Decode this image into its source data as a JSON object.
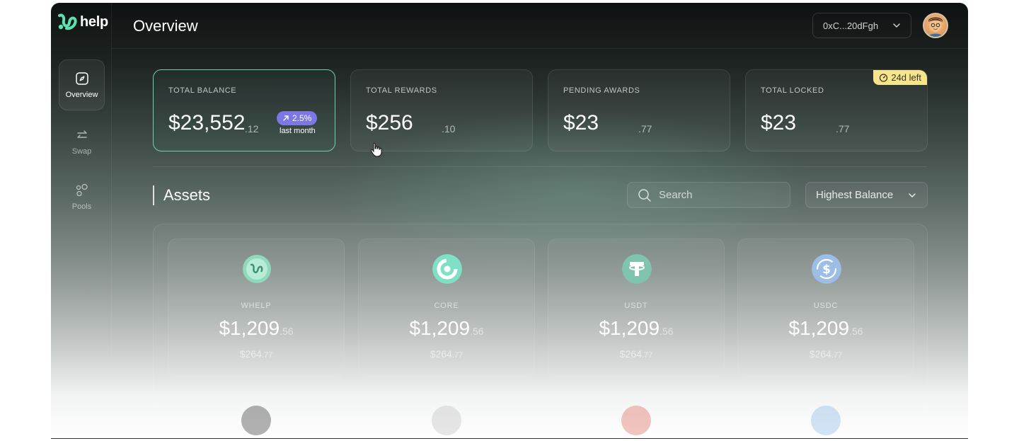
{
  "brand": {
    "name": "help"
  },
  "sidebar": {
    "items": [
      {
        "label": "Overview",
        "icon": "compass-icon",
        "active": true
      },
      {
        "label": "Swap",
        "icon": "swap-arrows-icon",
        "active": false
      },
      {
        "label": "Pools",
        "icon": "pools-bubbles-icon",
        "active": false
      }
    ]
  },
  "header": {
    "title": "Overview",
    "wallet_address": "0xC...20dFgh"
  },
  "stats": [
    {
      "label": "TOTAL BALANCE",
      "value": "$23,552",
      "cents": ".12",
      "change": "2.5%",
      "change_caption": "last month"
    },
    {
      "label": "TOTAL REWARDS",
      "value": "$256",
      "cents": ".10"
    },
    {
      "label": "PENDING AWARDS",
      "value": "$23",
      "cents": ".77"
    },
    {
      "label": "TOTAL LOCKED",
      "value": "$23",
      "cents": ".77",
      "badge": "24d left"
    }
  ],
  "assets": {
    "title": "Assets",
    "search_placeholder": "Search",
    "sort_label": "Highest Balance",
    "items": [
      {
        "name": "WHELP",
        "value": "$1,209",
        "value_cents": ".56",
        "sub": "$264",
        "sub_cents": ".77"
      },
      {
        "name": "CORE",
        "value": "$1,209",
        "value_cents": ".56",
        "sub": "$264",
        "sub_cents": ".77"
      },
      {
        "name": "USDT",
        "value": "$1,209",
        "value_cents": ".56",
        "sub": "$264",
        "sub_cents": ".77"
      },
      {
        "name": "USDC",
        "value": "$1,209",
        "value_cents": ".56",
        "sub": "$264",
        "sub_cents": ".77"
      }
    ]
  },
  "colors": {
    "accent_green": "#6fd1a8",
    "badge_purple": "#7b78e6",
    "badge_yellow": "#f7e58e"
  }
}
